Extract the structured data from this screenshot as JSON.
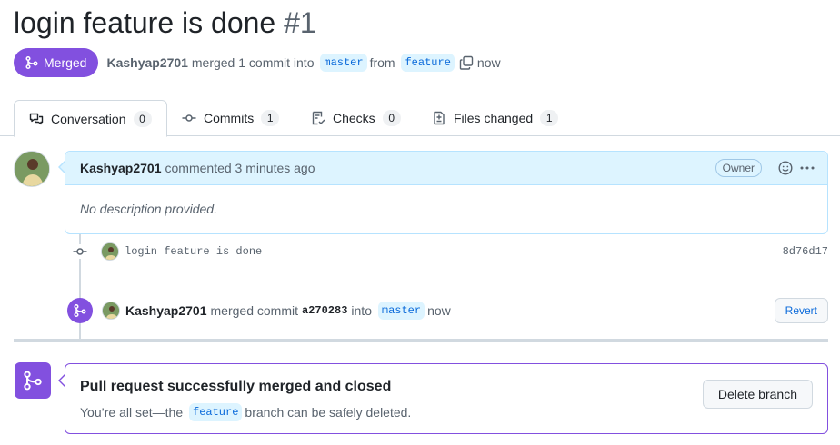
{
  "pr": {
    "title": "login feature is done",
    "number": "#1",
    "state": "Merged",
    "author": "Kashyap2701",
    "merged_text": "merged 1 commit into",
    "base_branch": "master",
    "from_text": "from",
    "head_branch": "feature",
    "time": "now"
  },
  "tabs": [
    {
      "label": "Conversation",
      "count": "0",
      "icon": "comment-discussion-icon"
    },
    {
      "label": "Commits",
      "count": "1",
      "icon": "git-commit-icon"
    },
    {
      "label": "Checks",
      "count": "0",
      "icon": "checklist-icon"
    },
    {
      "label": "Files changed",
      "count": "1",
      "icon": "file-diff-icon"
    }
  ],
  "comment": {
    "author": "Kashyap2701",
    "action": "commented 3 minutes ago",
    "role": "Owner",
    "body": "No description provided."
  },
  "commit": {
    "message": "login feature is done",
    "sha": "8d76d17"
  },
  "merge_event": {
    "author": "Kashyap2701",
    "action": "merged commit",
    "sha": "a270283",
    "into": "into",
    "branch": "master",
    "time": "now",
    "revert_label": "Revert"
  },
  "merge_box": {
    "title": "Pull request successfully merged and closed",
    "sub_before": "You’re all set—the",
    "branch": "feature",
    "sub_after": "branch can be safely deleted.",
    "delete_label": "Delete branch"
  },
  "colors": {
    "merged": "#8250df",
    "accent": "#0969da",
    "comment_header": "#ddf4ff"
  }
}
